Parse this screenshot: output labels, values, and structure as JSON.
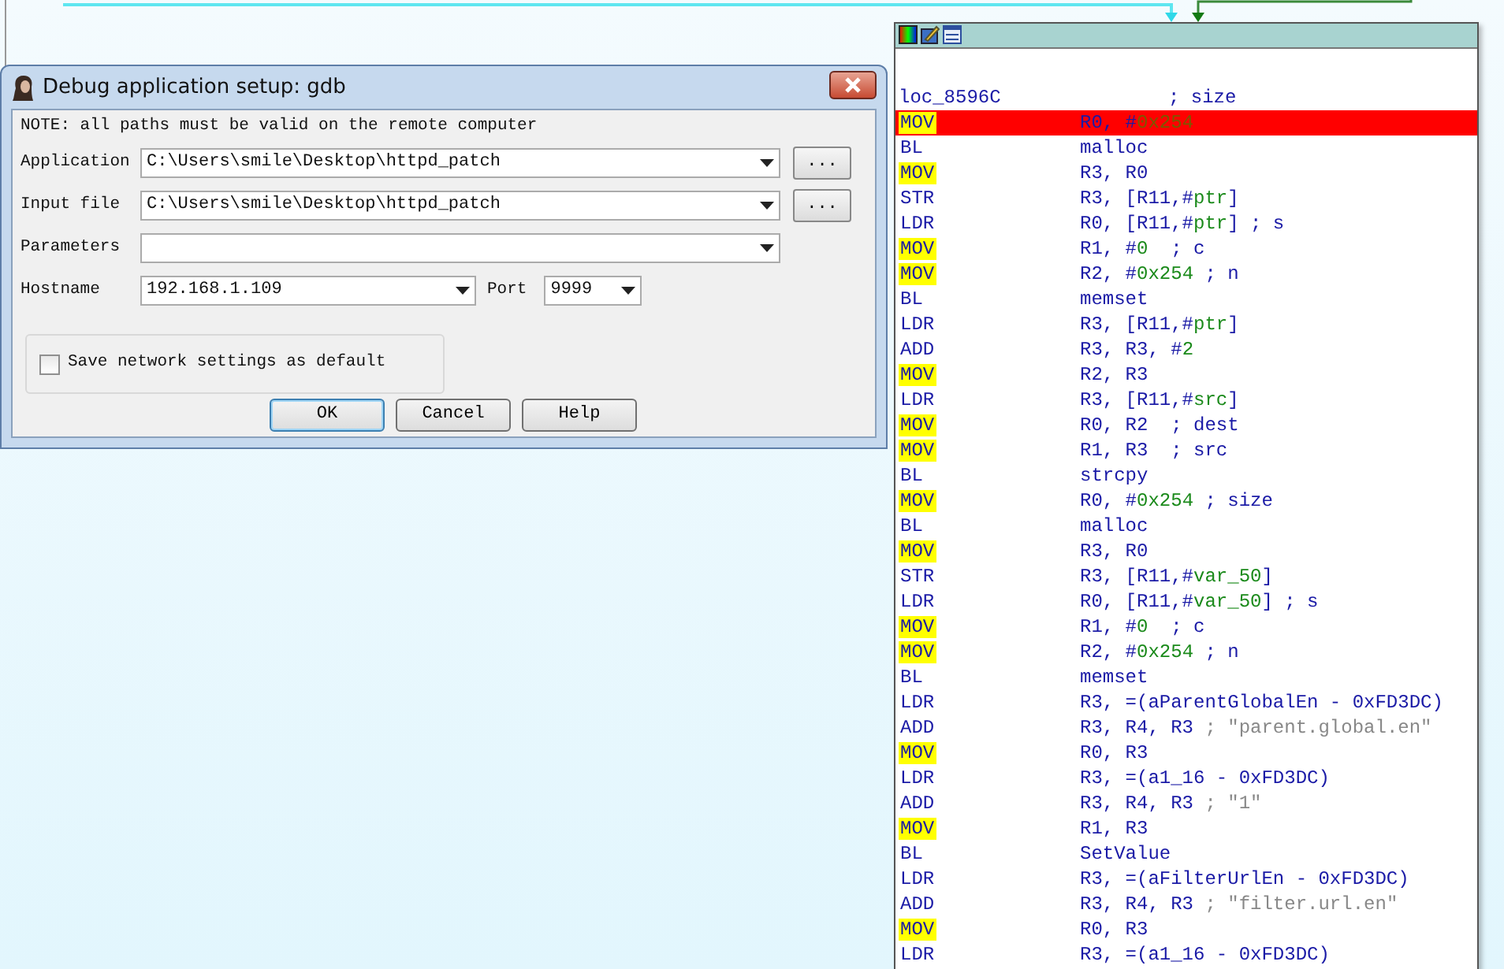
{
  "dialog": {
    "title": "Debug application setup: gdb",
    "note": "NOTE: all paths must be valid on the remote computer",
    "fields": [
      {
        "label": "Application",
        "value": "C:\\Users\\smile\\Desktop\\httpd_patch",
        "browse_button": "..."
      },
      {
        "label": "Input file",
        "value": "C:\\Users\\smile\\Desktop\\httpd_patch",
        "browse_button": "..."
      },
      {
        "label": "Parameters"
      }
    ],
    "hostname": {
      "label": "Hostname",
      "value": "192.168.1.109"
    },
    "port": {
      "label": "Port",
      "value": "9999"
    },
    "save_default": {
      "label": "Save network settings as default",
      "checked": false
    },
    "buttons": [
      {
        "label": "OK",
        "default": true
      },
      {
        "label": "Cancel",
        "default": false
      },
      {
        "label": "Help",
        "default": false
      }
    ]
  },
  "code_block": {
    "lines": [
      {
        "kind": "label",
        "label": "loc_8596C",
        "comment": "; size",
        "selected": false
      },
      {
        "kind": "instruction",
        "mnemonic": "MOV",
        "highlighted": true,
        "selected": true,
        "operands": [
          {
            "kind": "plain",
            "text": "R0, #"
          },
          {
            "kind": "number",
            "text": "0x254"
          }
        ]
      },
      {
        "kind": "instruction",
        "mnemonic": "BL",
        "highlighted": false,
        "selected": false,
        "operands": [
          {
            "kind": "plain",
            "text": "malloc"
          }
        ]
      },
      {
        "kind": "instruction",
        "mnemonic": "MOV",
        "highlighted": true,
        "selected": false,
        "operands": [
          {
            "kind": "plain",
            "text": "R3, R0"
          }
        ]
      },
      {
        "kind": "instruction",
        "mnemonic": "STR",
        "highlighted": false,
        "selected": false,
        "operands": [
          {
            "kind": "plain",
            "text": "R3, [R11,#"
          },
          {
            "kind": "variable",
            "text": "ptr"
          },
          {
            "kind": "plain",
            "text": "]"
          }
        ]
      },
      {
        "kind": "instruction",
        "mnemonic": "LDR",
        "highlighted": false,
        "selected": false,
        "operands": [
          {
            "kind": "plain",
            "text": "R0, [R11,#"
          },
          {
            "kind": "variable",
            "text": "ptr"
          },
          {
            "kind": "plain",
            "text": "] "
          },
          {
            "kind": "comment",
            "text": "; s"
          }
        ]
      },
      {
        "kind": "instruction",
        "mnemonic": "MOV",
        "highlighted": true,
        "selected": false,
        "operands": [
          {
            "kind": "plain",
            "text": "R1, #"
          },
          {
            "kind": "number",
            "text": "0"
          },
          {
            "kind": "comment",
            "text": "  ; c"
          }
        ]
      },
      {
        "kind": "instruction",
        "mnemonic": "MOV",
        "highlighted": true,
        "selected": false,
        "operands": [
          {
            "kind": "plain",
            "text": "R2, #"
          },
          {
            "kind": "number",
            "text": "0x254"
          },
          {
            "kind": "comment",
            "text": " ; n"
          }
        ]
      },
      {
        "kind": "instruction",
        "mnemonic": "BL",
        "highlighted": false,
        "selected": false,
        "operands": [
          {
            "kind": "plain",
            "text": "memset"
          }
        ]
      },
      {
        "kind": "instruction",
        "mnemonic": "LDR",
        "highlighted": false,
        "selected": false,
        "operands": [
          {
            "kind": "plain",
            "text": "R3, [R11,#"
          },
          {
            "kind": "variable",
            "text": "ptr"
          },
          {
            "kind": "plain",
            "text": "]"
          }
        ]
      },
      {
        "kind": "instruction",
        "mnemonic": "ADD",
        "highlighted": false,
        "selected": false,
        "operands": [
          {
            "kind": "plain",
            "text": "R3, R3, #"
          },
          {
            "kind": "number",
            "text": "2"
          }
        ]
      },
      {
        "kind": "instruction",
        "mnemonic": "MOV",
        "highlighted": true,
        "selected": false,
        "operands": [
          {
            "kind": "plain",
            "text": "R2, R3"
          }
        ]
      },
      {
        "kind": "instruction",
        "mnemonic": "LDR",
        "highlighted": false,
        "selected": false,
        "operands": [
          {
            "kind": "plain",
            "text": "R3, [R11,#"
          },
          {
            "kind": "variable",
            "text": "src"
          },
          {
            "kind": "plain",
            "text": "]"
          }
        ]
      },
      {
        "kind": "instruction",
        "mnemonic": "MOV",
        "highlighted": true,
        "selected": false,
        "operands": [
          {
            "kind": "plain",
            "text": "R0, R2  "
          },
          {
            "kind": "comment",
            "text": "; dest"
          }
        ]
      },
      {
        "kind": "instruction",
        "mnemonic": "MOV",
        "highlighted": true,
        "selected": false,
        "operands": [
          {
            "kind": "plain",
            "text": "R1, R3  "
          },
          {
            "kind": "comment",
            "text": "; src"
          }
        ]
      },
      {
        "kind": "instruction",
        "mnemonic": "BL",
        "highlighted": false,
        "selected": false,
        "operands": [
          {
            "kind": "plain",
            "text": "strcpy"
          }
        ]
      },
      {
        "kind": "instruction",
        "mnemonic": "MOV",
        "highlighted": true,
        "selected": false,
        "operands": [
          {
            "kind": "plain",
            "text": "R0, #"
          },
          {
            "kind": "number",
            "text": "0x254"
          },
          {
            "kind": "comment",
            "text": " ; size"
          }
        ]
      },
      {
        "kind": "instruction",
        "mnemonic": "BL",
        "highlighted": false,
        "selected": false,
        "operands": [
          {
            "kind": "plain",
            "text": "malloc"
          }
        ]
      },
      {
        "kind": "instruction",
        "mnemonic": "MOV",
        "highlighted": true,
        "selected": false,
        "operands": [
          {
            "kind": "plain",
            "text": "R3, R0"
          }
        ]
      },
      {
        "kind": "instruction",
        "mnemonic": "STR",
        "highlighted": false,
        "selected": false,
        "operands": [
          {
            "kind": "plain",
            "text": "R3, [R11,#"
          },
          {
            "kind": "variable",
            "text": "var_50"
          },
          {
            "kind": "plain",
            "text": "]"
          }
        ]
      },
      {
        "kind": "instruction",
        "mnemonic": "LDR",
        "highlighted": false,
        "selected": false,
        "operands": [
          {
            "kind": "plain",
            "text": "R0, [R11,#"
          },
          {
            "kind": "variable",
            "text": "var_50"
          },
          {
            "kind": "plain",
            "text": "] "
          },
          {
            "kind": "comment",
            "text": "; s"
          }
        ]
      },
      {
        "kind": "instruction",
        "mnemonic": "MOV",
        "highlighted": true,
        "selected": false,
        "operands": [
          {
            "kind": "plain",
            "text": "R1, #"
          },
          {
            "kind": "number",
            "text": "0"
          },
          {
            "kind": "comment",
            "text": "  ; c"
          }
        ]
      },
      {
        "kind": "instruction",
        "mnemonic": "MOV",
        "highlighted": true,
        "selected": false,
        "operands": [
          {
            "kind": "plain",
            "text": "R2, #"
          },
          {
            "kind": "number",
            "text": "0x254"
          },
          {
            "kind": "comment",
            "text": " ; n"
          }
        ]
      },
      {
        "kind": "instruction",
        "mnemonic": "BL",
        "highlighted": false,
        "selected": false,
        "operands": [
          {
            "kind": "plain",
            "text": "memset"
          }
        ]
      },
      {
        "kind": "instruction",
        "mnemonic": "LDR",
        "highlighted": false,
        "selected": false,
        "operands": [
          {
            "kind": "plain",
            "text": "R3, =(aParentGlobalEn - 0xFD3DC)"
          }
        ]
      },
      {
        "kind": "instruction",
        "mnemonic": "ADD",
        "highlighted": false,
        "selected": false,
        "operands": [
          {
            "kind": "plain",
            "text": "R3, R4, R3 "
          },
          {
            "kind": "string",
            "text": "; \"parent.global.en\""
          }
        ]
      },
      {
        "kind": "instruction",
        "mnemonic": "MOV",
        "highlighted": true,
        "selected": false,
        "operands": [
          {
            "kind": "plain",
            "text": "R0, R3"
          }
        ]
      },
      {
        "kind": "instruction",
        "mnemonic": "LDR",
        "highlighted": false,
        "selected": false,
        "operands": [
          {
            "kind": "plain",
            "text": "R3, =(a1_16 - 0xFD3DC)"
          }
        ]
      },
      {
        "kind": "instruction",
        "mnemonic": "ADD",
        "highlighted": false,
        "selected": false,
        "operands": [
          {
            "kind": "plain",
            "text": "R3, R4, R3 "
          },
          {
            "kind": "string",
            "text": "; \"1\""
          }
        ]
      },
      {
        "kind": "instruction",
        "mnemonic": "MOV",
        "highlighted": true,
        "selected": false,
        "operands": [
          {
            "kind": "plain",
            "text": "R1, R3"
          }
        ]
      },
      {
        "kind": "instruction",
        "mnemonic": "BL",
        "highlighted": false,
        "selected": false,
        "operands": [
          {
            "kind": "plain",
            "text": "SetValue"
          }
        ]
      },
      {
        "kind": "instruction",
        "mnemonic": "LDR",
        "highlighted": false,
        "selected": false,
        "operands": [
          {
            "kind": "plain",
            "text": "R3, =(aFilterUrlEn - 0xFD3DC)"
          }
        ]
      },
      {
        "kind": "instruction",
        "mnemonic": "ADD",
        "highlighted": false,
        "selected": false,
        "operands": [
          {
            "kind": "plain",
            "text": "R3, R4, R3 "
          },
          {
            "kind": "string",
            "text": "; \"filter.url.en\""
          }
        ]
      },
      {
        "kind": "instruction",
        "mnemonic": "MOV",
        "highlighted": true,
        "selected": false,
        "operands": [
          {
            "kind": "plain",
            "text": "R0, R3"
          }
        ]
      },
      {
        "kind": "instruction",
        "mnemonic": "LDR",
        "highlighted": false,
        "selected": false,
        "operands": [
          {
            "kind": "plain",
            "text": "R3, =(a1_16 - 0xFD3DC)"
          }
        ]
      }
    ]
  }
}
